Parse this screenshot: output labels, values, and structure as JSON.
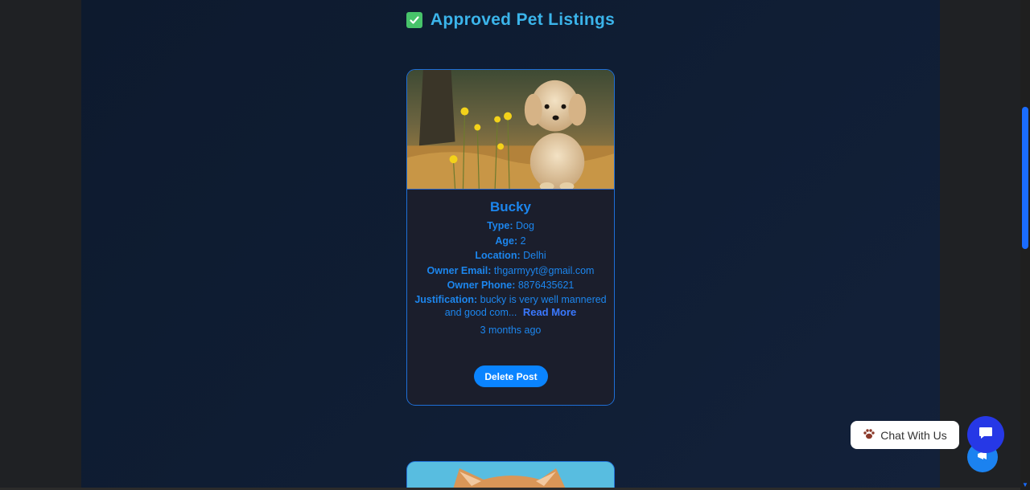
{
  "heading": {
    "icon": "check-box-icon",
    "title": "Approved Pet Listings"
  },
  "listing": {
    "name": "Bucky",
    "type_label": "Type:",
    "type": "Dog",
    "age_label": "Age:",
    "age": "2",
    "location_label": "Location:",
    "location": "Delhi",
    "email_label": "Owner Email:",
    "email": "thgarmyyt@gmail.com",
    "phone_label": "Owner Phone:",
    "phone": "8876435621",
    "justification_label": "Justification:",
    "justification": "bucky is very well mannered and good com...",
    "read_more": "Read More",
    "posted": "3 months ago",
    "delete_label": "Delete Post"
  },
  "chat": {
    "label": "Chat With Us",
    "paw_icon": "paw-icon",
    "chat_icon": "chat-bubble-icon",
    "notify_icon": "megaphone-icon"
  },
  "colors": {
    "accent": "#1c86ee",
    "heading": "#3bb4ea",
    "button": "#0a84ff",
    "chat": "#2638e6",
    "scroll": "#1a6cff"
  }
}
